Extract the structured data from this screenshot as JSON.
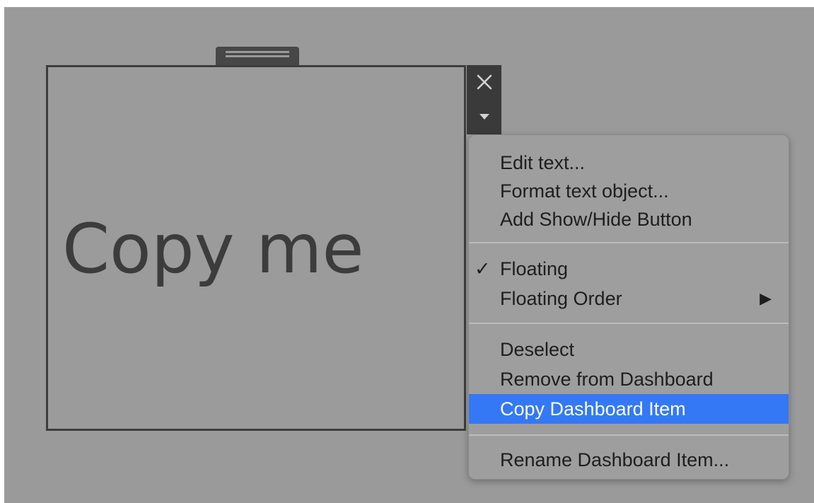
{
  "text_object": {
    "content": "Copy me"
  },
  "controls": {
    "close_icon": "close-icon",
    "dropdown_icon": "caret-down-icon"
  },
  "context_menu": {
    "items": [
      {
        "label": "Edit text..."
      },
      {
        "label": "Format text object..."
      },
      {
        "label": "Add Show/Hide Button"
      },
      {
        "label": "Floating",
        "checked": true,
        "check_glyph": "✓"
      },
      {
        "label": "Floating Order",
        "submenu_glyph": "▶"
      },
      {
        "label": "Deselect"
      },
      {
        "label": "Remove from Dashboard"
      },
      {
        "label": "Copy Dashboard Item",
        "highlighted": true
      },
      {
        "label": "Rename Dashboard Item..."
      }
    ]
  },
  "colors": {
    "highlight": "#3478f6",
    "background": "#9a9a9a",
    "border": "#3d3d3d"
  }
}
